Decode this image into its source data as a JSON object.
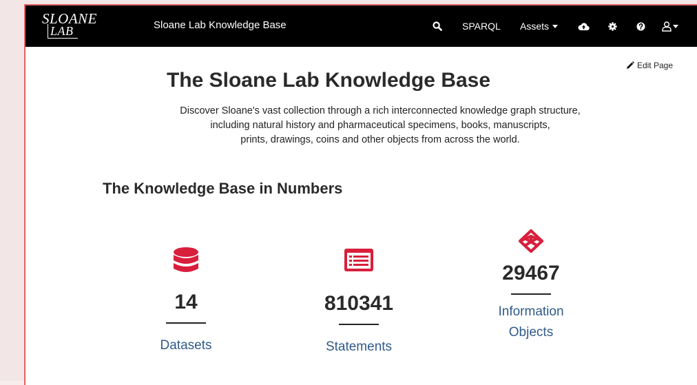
{
  "navbar": {
    "logo_line1": "SLOANE",
    "logo_line2": "LAB",
    "site_title": "Sloane Lab Knowledge Base",
    "search_icon": "search-icon",
    "sparql_label": "SPARQL",
    "assets_label": "Assets",
    "upload_icon": "cloud-upload-icon",
    "settings_icon": "gear-icon",
    "help_icon": "question-circle-icon",
    "user_icon": "user-icon"
  },
  "page": {
    "edit_label": "Edit Page",
    "title": "The Sloane Lab Knowledge Base",
    "description_lines": [
      "Discover Sloane's vast collection through a rich interconnected knowledge graph structure,",
      "including natural history and pharmaceutical specimens, books, manuscripts,",
      "prints, drawings, coins and other objects from across the world."
    ],
    "section_title": "The Knowledge Base in Numbers"
  },
  "stats": [
    {
      "icon": "database-icon",
      "value": "14",
      "label_lines": [
        "Datasets"
      ]
    },
    {
      "icon": "list-icon",
      "value": "810341",
      "label_lines": [
        "Statements"
      ]
    },
    {
      "icon": "cube-outline-icon",
      "value": "29467",
      "label_lines": [
        "Information",
        "Objects"
      ]
    }
  ],
  "colors": {
    "accent": "#d81f3c",
    "link": "#2f5a8a",
    "navbar_bg": "#000000",
    "page_frame": "#e06464"
  }
}
